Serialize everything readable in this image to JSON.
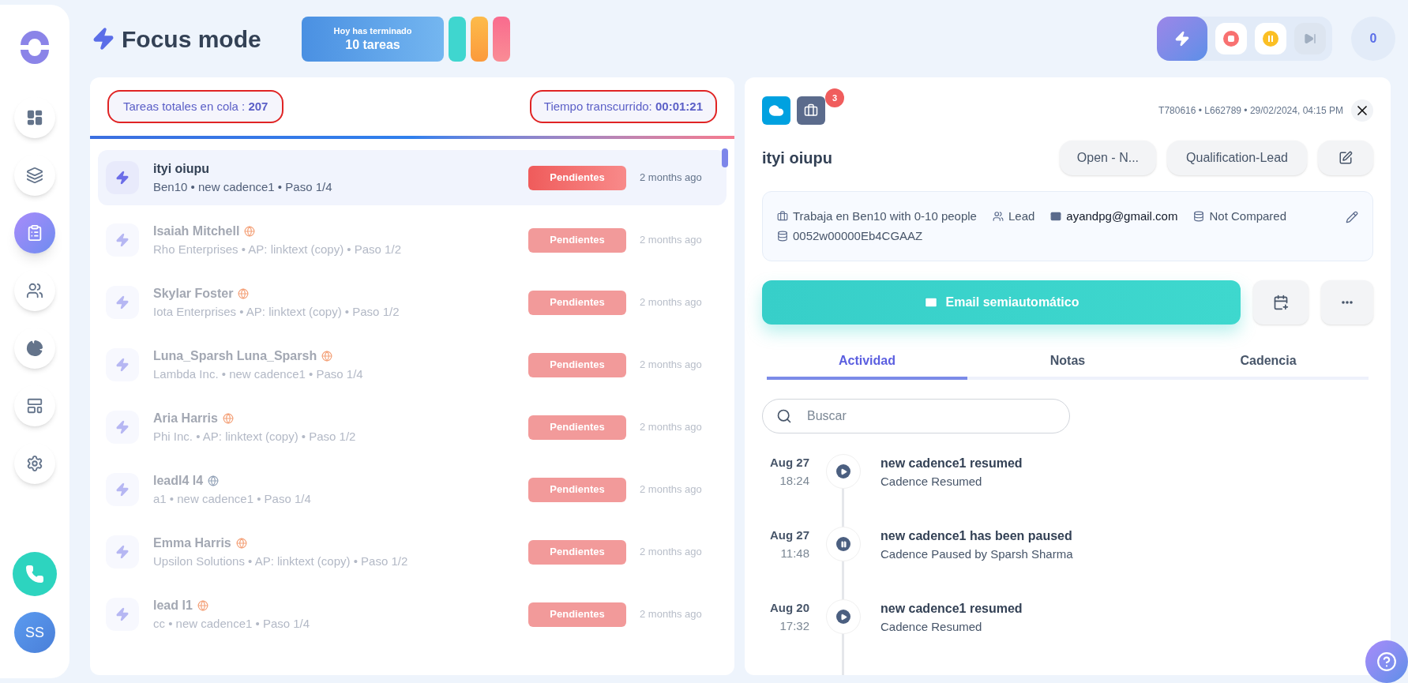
{
  "sidebar": {
    "items": [
      {
        "kind": "dashboard",
        "selected": false
      },
      {
        "kind": "layers",
        "selected": false
      },
      {
        "kind": "tasks",
        "selected": true
      },
      {
        "kind": "people",
        "selected": false
      },
      {
        "kind": "chart",
        "selected": false
      },
      {
        "kind": "layout",
        "selected": false
      },
      {
        "kind": "settings",
        "selected": false
      }
    ],
    "avatar": "SS"
  },
  "header": {
    "title": "Focus mode",
    "done_label": "Hoy has terminado",
    "done_count": "10 tareas",
    "counter": "0",
    "skip_disabled": true
  },
  "queue": {
    "total_label": "Tareas totales en cola :",
    "total": "207",
    "time_label": "Tiempo transcurrido:",
    "time": "00:01:21",
    "rows": [
      {
        "name": "ityi oiupu",
        "detail": "Ben10 • new cadence1 • Paso 1/4",
        "status": "Pendientes",
        "age": "2 months ago",
        "selected": true
      },
      {
        "name": "Isaiah Mitchell",
        "color": "#f4a27a",
        "detail": "Rho Enterprises • AP: linktext (copy) • Paso 1/2",
        "status": "Pendientes",
        "age": "2 months ago",
        "selected": false
      },
      {
        "name": "Skylar Foster",
        "color": "#f4a27a",
        "detail": "Iota Enterprises • AP: linktext (copy) • Paso 1/2",
        "status": "Pendientes",
        "age": "2 months ago",
        "selected": false
      },
      {
        "name": "Luna_Sparsh Luna_Sparsh",
        "color": "#f4a27a",
        "detail": "Lambda Inc. • new cadence1 • Paso 1/4",
        "status": "Pendientes",
        "age": "2 months ago",
        "selected": false
      },
      {
        "name": "Aria Harris",
        "color": "#f4a27a",
        "detail": "Phi Inc. • AP: linktext (copy) • Paso 1/2",
        "status": "Pendientes",
        "age": "2 months ago",
        "selected": false
      },
      {
        "name": "leadl4 l4",
        "color": "#94a3b8",
        "detail": "a1 • new cadence1 • Paso 1/4",
        "status": "Pendientes",
        "age": "2 months ago",
        "selected": false
      },
      {
        "name": "Emma Harris",
        "color": "#f4a27a",
        "detail": "Upsilon Solutions • AP: linktext (copy) • Paso 1/2",
        "status": "Pendientes",
        "age": "2 months ago",
        "selected": false
      },
      {
        "name": "lead l1",
        "color": "#f4a27a",
        "detail": "cc • new cadence1 • Paso 1/4",
        "status": "Pendientes",
        "age": "2 months ago",
        "selected": false
      }
    ]
  },
  "detail": {
    "badge": "3",
    "meta": "T780616 • L662789 • 29/02/2024, 04:15 PM",
    "name": "ityi oiupu",
    "status_button": "Open - N...",
    "stage_button": "Qualification-Lead",
    "info": [
      {
        "kind": "company",
        "text": "Trabaja en Ben10 with 0-10 people"
      },
      {
        "kind": "role",
        "text": "Lead"
      },
      {
        "kind": "email",
        "text": "ayandpg@gmail.com"
      },
      {
        "kind": "db",
        "text": "Not Compared"
      },
      {
        "kind": "db",
        "text": "0052w00000Eb4CGAAZ"
      }
    ],
    "action": "Email semiautomático",
    "tabs": [
      {
        "label": "Actividad",
        "selected": true
      },
      {
        "label": "Notas",
        "selected": false
      },
      {
        "label": "Cadencia",
        "selected": false
      }
    ],
    "search": {
      "placeholder": "Buscar"
    },
    "timeline": [
      {
        "date": "Aug 27",
        "time": "18:24",
        "kind": "resumed",
        "title": "new cadence1 resumed",
        "text": "Cadence Resumed"
      },
      {
        "date": "Aug 27",
        "time": "11:48",
        "kind": "paused",
        "title": "new cadence1 has been paused",
        "text": "Cadence Paused by Sparsh Sharma"
      },
      {
        "date": "Aug 20",
        "time": "17:32",
        "kind": "resumed",
        "title": "new cadence1 resumed",
        "text": "Cadence Resumed"
      }
    ]
  }
}
